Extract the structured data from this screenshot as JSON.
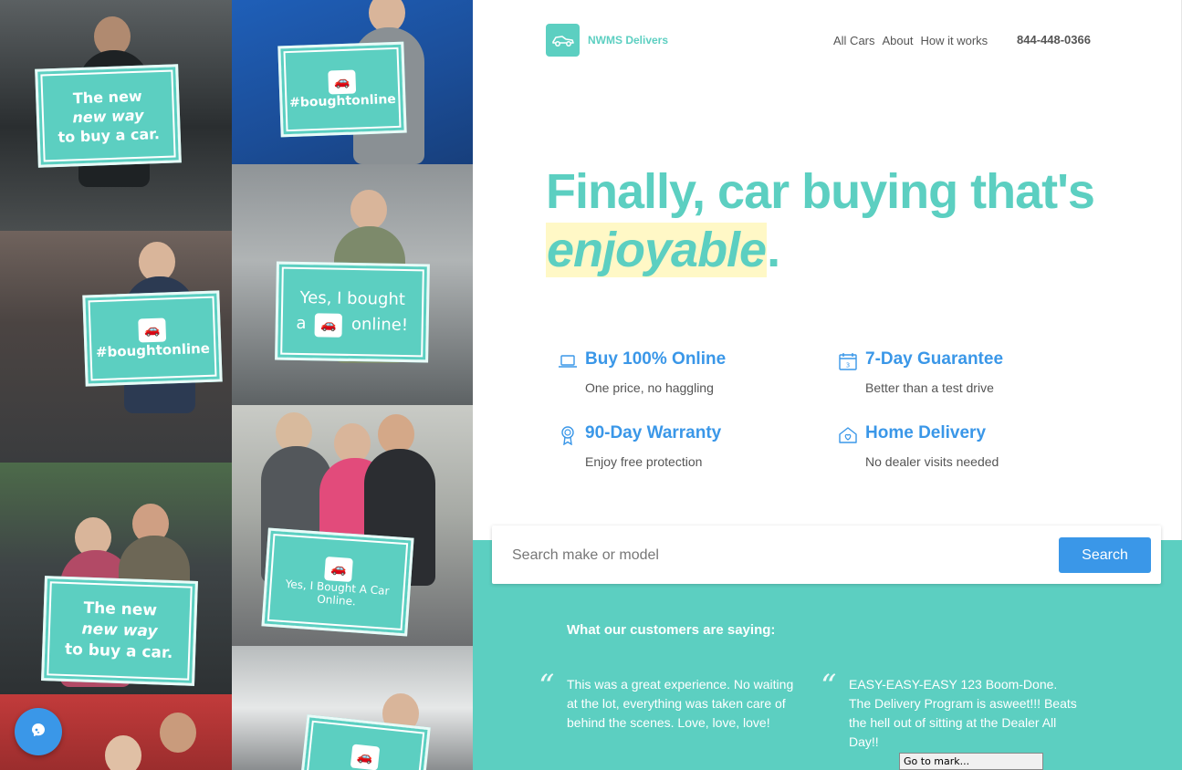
{
  "brand": {
    "name": "NWMS Delivers",
    "color": "#5ccfc1"
  },
  "nav": {
    "items": [
      "All Cars",
      "About",
      "How it works"
    ],
    "phone": "844-448-0366"
  },
  "hero": {
    "line1": "Finally, car buying that's",
    "highlight": "enjoyable",
    "period": "."
  },
  "features": [
    {
      "icon": "laptop-icon",
      "title": "Buy 100% Online",
      "subtitle": "One price, no haggling"
    },
    {
      "icon": "calendar-icon",
      "title": "7-Day Guarantee",
      "subtitle": "Better than a test drive"
    },
    {
      "icon": "ribbon-icon",
      "title": "90-Day Warranty",
      "subtitle": "Enjoy free protection"
    },
    {
      "icon": "home-heart-icon",
      "title": "Home Delivery",
      "subtitle": "No dealer visits needed"
    }
  ],
  "search": {
    "placeholder": "Search make or model",
    "button": "Search"
  },
  "reviews": {
    "title": "What our customers are saying:",
    "items": [
      "This was a great experience. No waiting at the lot, everything was taken care of behind the scenes. Love, love, love!",
      "EASY-EASY-EASY 123 Boom-Done. The Delivery Program is asweet!!! Beats the hell out of sitting at the Dealer All Day!!"
    ]
  },
  "collage": {
    "signs": [
      {
        "lines": [
          "The new",
          "new way",
          "to buy a car."
        ]
      },
      {
        "lines": [
          "#boughtonline"
        ]
      },
      {
        "lines": [
          "#boughtonline"
        ]
      },
      {
        "lines": [
          "Yes, I bought",
          "a",
          "online!"
        ]
      },
      {
        "lines": [
          "The new",
          "new way",
          "to buy a car."
        ]
      },
      {
        "lines": [
          "Yes, I Bought A Car Online."
        ]
      }
    ]
  },
  "goto": "Go to mark...",
  "colors": {
    "accent": "#5ccfc1",
    "primary": "#3a97e8",
    "highlight": "#fff8c6"
  }
}
